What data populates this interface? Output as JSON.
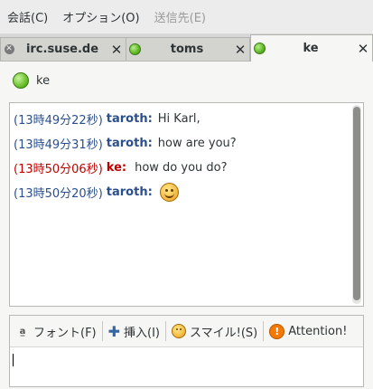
{
  "menubar": {
    "items": [
      {
        "label": "会話(C)",
        "disabled": false
      },
      {
        "label": "オプション(O)",
        "disabled": false
      },
      {
        "label": "送信先(E)",
        "disabled": true
      }
    ]
  },
  "tabs": [
    {
      "label": "irc.suse.de",
      "close": "✕",
      "icon": "irc-x-icon",
      "active": false
    },
    {
      "label": "toms",
      "close": "✕",
      "icon": "online-status-icon",
      "active": false
    },
    {
      "label": "ke",
      "close": "✕",
      "icon": "online-status-icon",
      "active": true
    }
  ],
  "buddy": {
    "name": "ke"
  },
  "messages": [
    {
      "timestamp": "(13時49分22秒)",
      "nick": "taroth:",
      "text": "Hi Karl,",
      "from_self": true
    },
    {
      "timestamp": "(13時49分31秒)",
      "nick": "taroth:",
      "text": "how are you?",
      "from_self": true
    },
    {
      "timestamp": "(13時50分06秒)",
      "nick": "ke:",
      "text": "how do you do?",
      "from_self": false
    },
    {
      "timestamp": "(13時50分20秒)",
      "nick": "taroth:",
      "text": "",
      "emoticon": "smiley-icon",
      "from_self": true
    }
  ],
  "toolbar": {
    "font_label": "フォント(F)",
    "insert_label": "挿入(I)",
    "smiley_label": "スマイル!(S)",
    "attention_label": "Attention!"
  },
  "colors": {
    "self_nick": "#2a4f8c",
    "other_nick": "#c00000",
    "online": "#5fb526"
  }
}
